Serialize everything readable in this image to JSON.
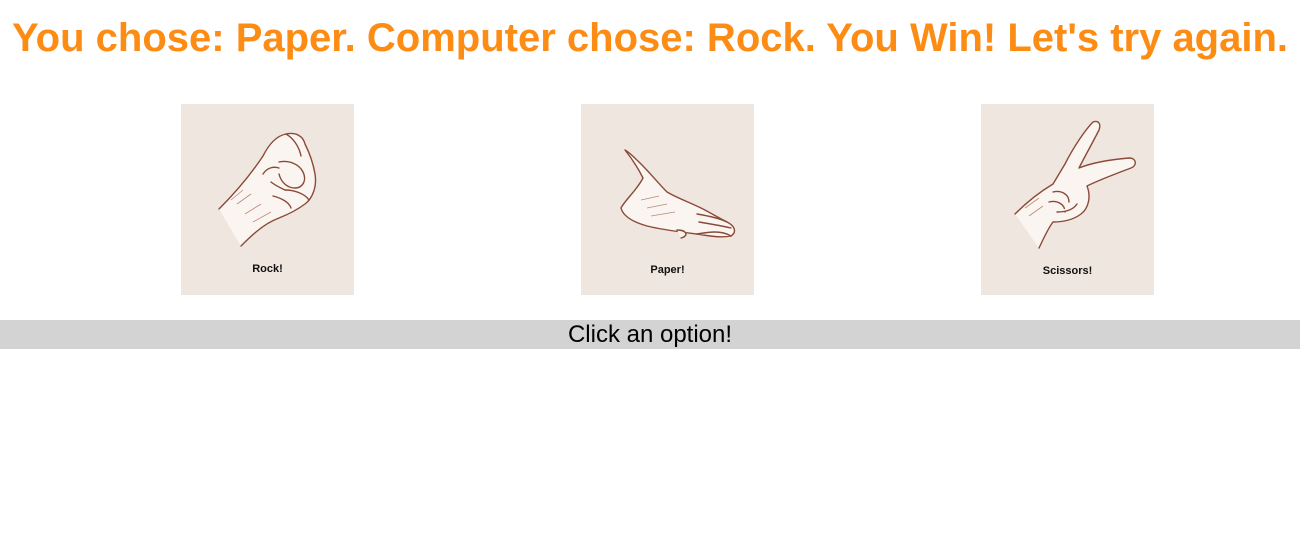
{
  "header": {
    "result_text": "You chose: Paper. Computer chose: Rock. You Win! Let's try again."
  },
  "options": [
    {
      "label": "Rock!",
      "icon": "rock-hand-icon"
    },
    {
      "label": "Paper!",
      "icon": "paper-hand-icon"
    },
    {
      "label": "Scissors!",
      "icon": "scissors-hand-icon"
    }
  ],
  "status": {
    "prompt": "Click an option!"
  },
  "colors": {
    "title": "#fd8c14",
    "card_background": "#f0e6e0",
    "status_bar": "#d3d3d3",
    "sketch_line": "#8a4a38"
  }
}
